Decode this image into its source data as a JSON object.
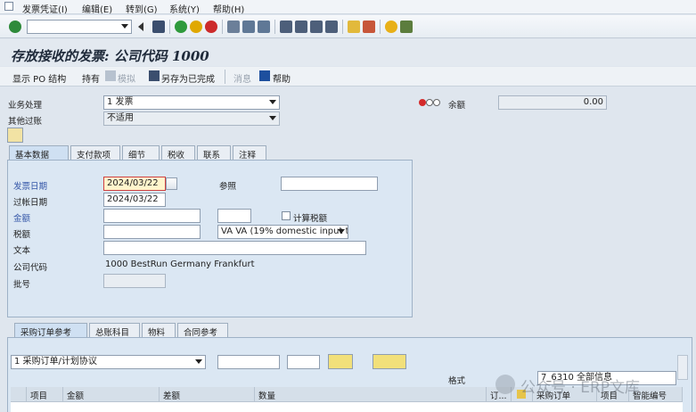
{
  "menu": {
    "items": [
      "发票凭证(I)",
      "编辑(E)",
      "转到(G)",
      "系统(Y)",
      "帮助(H)"
    ]
  },
  "page_title": "存放接收的发票: 公司代码 1000",
  "app_toolbar": {
    "show_po_structure": "显示 PO 结构",
    "hold": "持有",
    "simulate": "模拟",
    "save_completed": "另存为已完成",
    "messages": "消息",
    "help": "帮助"
  },
  "header": {
    "transaction_label": "业务处理",
    "transaction_value": "1 发票",
    "other_posting_label": "其他过账",
    "other_posting_value": "不适用",
    "balance_label": "余额",
    "balance_value": "0.00"
  },
  "tabs": [
    "基本数据",
    "支付款项",
    "细节",
    "税收",
    "联系",
    "注释"
  ],
  "basic_data": {
    "invoice_date_label": "发票日期",
    "invoice_date_value": "2024/03/22",
    "reference_label": "参照",
    "reference_value": "",
    "posting_date_label": "过帐日期",
    "posting_date_value": "2024/03/22",
    "amount_label": "金额",
    "amount_value": "",
    "currency_value": "",
    "calc_tax_label": "计算税额",
    "tax_amount_label": "税额",
    "tax_amount_value": "",
    "tax_code_value": "VA VA (19% domestic input t...",
    "text_label": "文本",
    "text_value": "",
    "company_code_label": "公司代码",
    "company_code_value": "1000 BestRun Germany Frankfurt",
    "lot_label": "批号",
    "lot_value": ""
  },
  "ref_tabs": [
    "采购订单参考",
    "总账科目",
    "物料",
    "合同参考"
  ],
  "ref": {
    "doc_type_value": "1 采购订单/计划协议",
    "format_label": "格式",
    "layout_value": "7_6310 全部信息"
  },
  "grid_columns": [
    "项目",
    "金额",
    "差额",
    "数量",
    "订...",
    "采购订单",
    "项目",
    "智能编号"
  ],
  "watermark": "公众号 · ERP文库",
  "colors": {
    "title_bg": "#e3e9f0",
    "panel_bg": "#dbe7f3",
    "required_bg": "#fff5cc"
  }
}
